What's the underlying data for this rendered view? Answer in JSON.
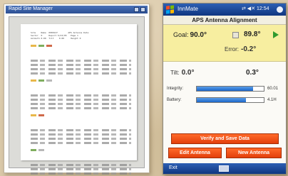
{
  "left_device": {
    "window_title": "Rapid Site Manager",
    "report_text": "Site    Name  0000127        APS Antenna Data\nSector  0     Report 6/23/05   Page 1\nAzimuth 0.00  Tilt    0.00     Height 0",
    "report_colors": [
      "#e8b84a",
      "#7fae5e",
      "#d06a4a",
      "#b8b8b8"
    ]
  },
  "right_device": {
    "app_name": "InnMate",
    "status": "⇄ ◀✕ 12:54",
    "screen_title": "APS Antenna Alignment",
    "goal": {
      "label": "Goal:",
      "value": "90.0°"
    },
    "current": {
      "value": "89.8°"
    },
    "error": {
      "label": "Error:",
      "value": "-0.2°"
    },
    "tilt": {
      "label": "Tilt:",
      "goal": "0.0°",
      "current": "0.3°"
    },
    "integrity": {
      "label": "Integrity:",
      "level": 0.84,
      "value": "60.01"
    },
    "battery": {
      "label": "Battery:",
      "level": 0.73,
      "value": "4.1H"
    },
    "buttons": {
      "verify": "Verify and Save Data",
      "edit": "Edit Antenna",
      "new": "New Antenna"
    },
    "menu": {
      "exit": "Exit"
    },
    "colors": {
      "accent": "#ff6a2a",
      "goal_bg": "#f7eea0",
      "title_bar": "#1e4aa0"
    }
  }
}
